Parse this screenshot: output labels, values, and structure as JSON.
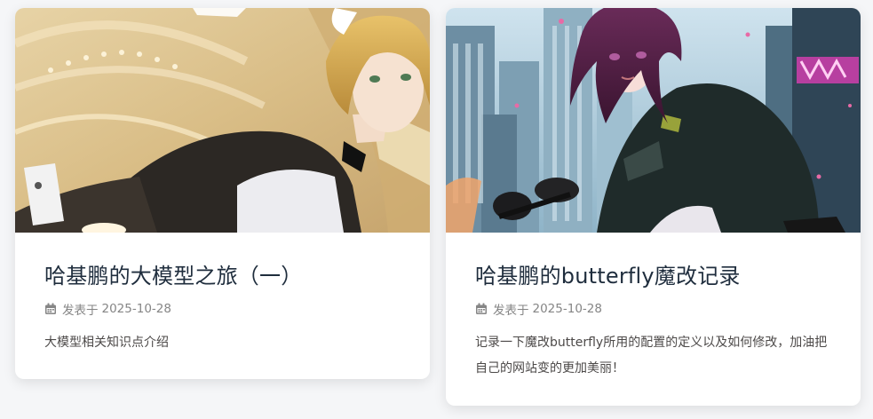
{
  "posts": [
    {
      "title": "哈基鹏的大模型之旅（一）",
      "meta_label": "发表于",
      "date": "2025-10-28",
      "excerpt": "大模型相关知识点介绍",
      "cover_icon": "anime-girl-bunny-cover-image"
    },
    {
      "title": "哈基鹏的butterfly魔改记录",
      "meta_label": "发表于",
      "date": "2025-10-28",
      "excerpt": "记录一下魔改butterfly所用的配置的定义以及如何修改，加油把自己的网站变的更加美丽！",
      "cover_icon": "anime-girl-city-cover-image"
    }
  ],
  "colors": {
    "title": "#1f2d3d",
    "meta": "#858585",
    "excerpt": "#4c4948",
    "card_bg": "#ffffff"
  }
}
